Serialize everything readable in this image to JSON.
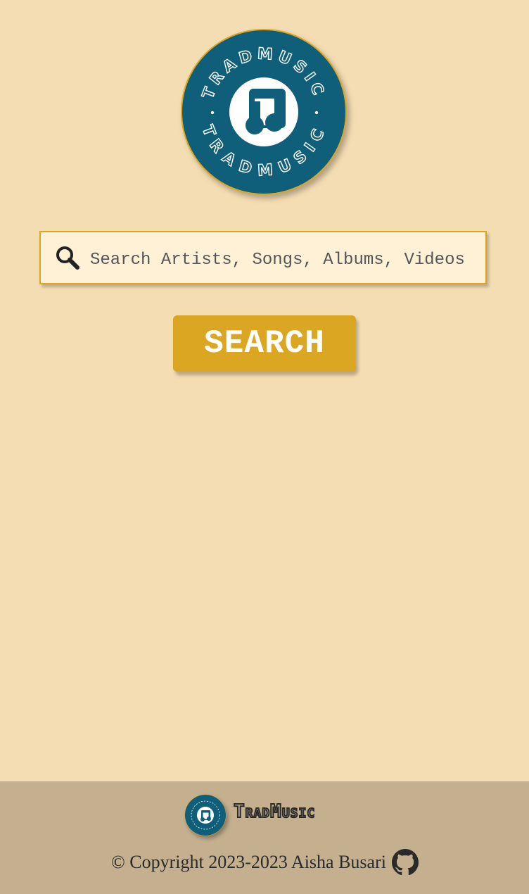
{
  "logo": {
    "ring_text_top": "TRADMUSIC",
    "ring_text_bottom": "TRADMUSIC",
    "icon": "music-note-icon",
    "colors": {
      "badge": "#0f5f7a",
      "ring_text": "#ffffff",
      "outer_ring": "#dba722"
    }
  },
  "search": {
    "icon": "search-icon",
    "placeholder": "Search Artists, Songs, Albums, Videos",
    "value": ""
  },
  "search_button": {
    "label": "SEARCH"
  },
  "footer": {
    "brand": "TradMusic",
    "copyright": "© Copyright 2023-2023 Aisha Busari",
    "github_icon": "github-icon"
  },
  "colors": {
    "background": "#f5ddb3",
    "accent": "#dba722",
    "footer_background": "#c4b08f"
  }
}
